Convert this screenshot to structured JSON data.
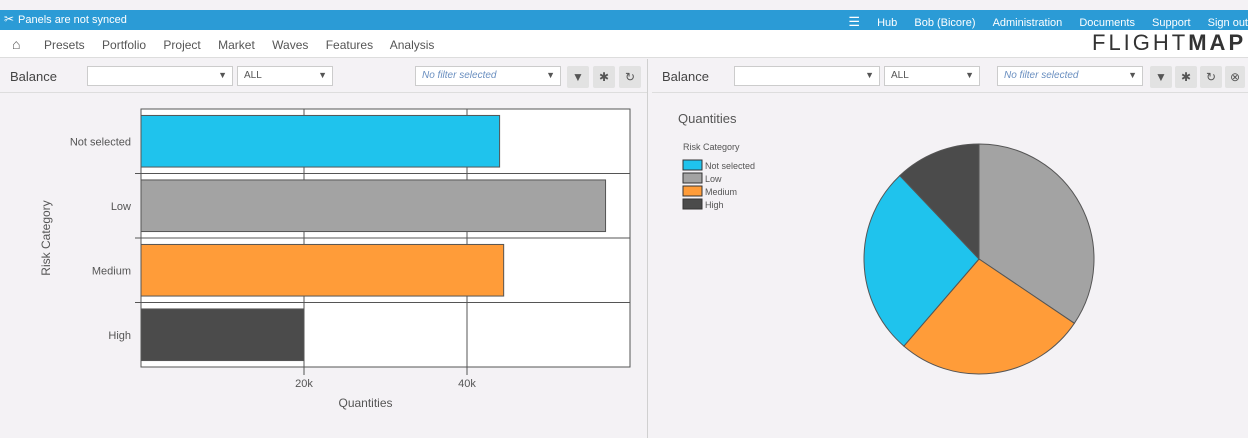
{
  "topbar": {
    "sync_status": "Panels are not synced",
    "links": [
      "Hub",
      "Bob (Bicore)",
      "Administration",
      "Documents",
      "Support",
      "Sign out"
    ]
  },
  "nav": {
    "items": [
      "Presets",
      "Portfolio",
      "Project",
      "Market",
      "Waves",
      "Features",
      "Analysis"
    ]
  },
  "logo": {
    "light": "FLIGHT",
    "bold": "MAP"
  },
  "left_panel": {
    "title": "Balance",
    "select1": "",
    "select2": "ALL",
    "filter_placeholder": "No filter selected"
  },
  "right_panel": {
    "title": "Balance",
    "select1": "",
    "select2": "ALL",
    "filter_placeholder": "No filter selected"
  },
  "chart_data": [
    {
      "type": "bar",
      "orientation": "horizontal",
      "categories": [
        "Not selected",
        "Low",
        "Medium",
        "High"
      ],
      "values": [
        44000,
        57000,
        44500,
        20000
      ],
      "colors": [
        "#1fc3ed",
        "#a3a3a3",
        "#ff9c39",
        "#4b4b4b"
      ],
      "xlabel": "Quantities",
      "ylabel": "Risk Category",
      "xlim": [
        0,
        60000
      ],
      "xticks": [
        20000,
        40000
      ],
      "xtick_labels": [
        "20k",
        "40k"
      ],
      "grid": true
    },
    {
      "type": "pie",
      "title": "Quantities",
      "legend_title": "Risk Category",
      "categories": [
        "Not selected",
        "Low",
        "Medium",
        "High"
      ],
      "values": [
        44000,
        57000,
        44500,
        20000
      ],
      "colors": [
        "#1fc3ed",
        "#a3a3a3",
        "#ff9c39",
        "#4b4b4b"
      ],
      "legend_position": "top-left"
    }
  ]
}
